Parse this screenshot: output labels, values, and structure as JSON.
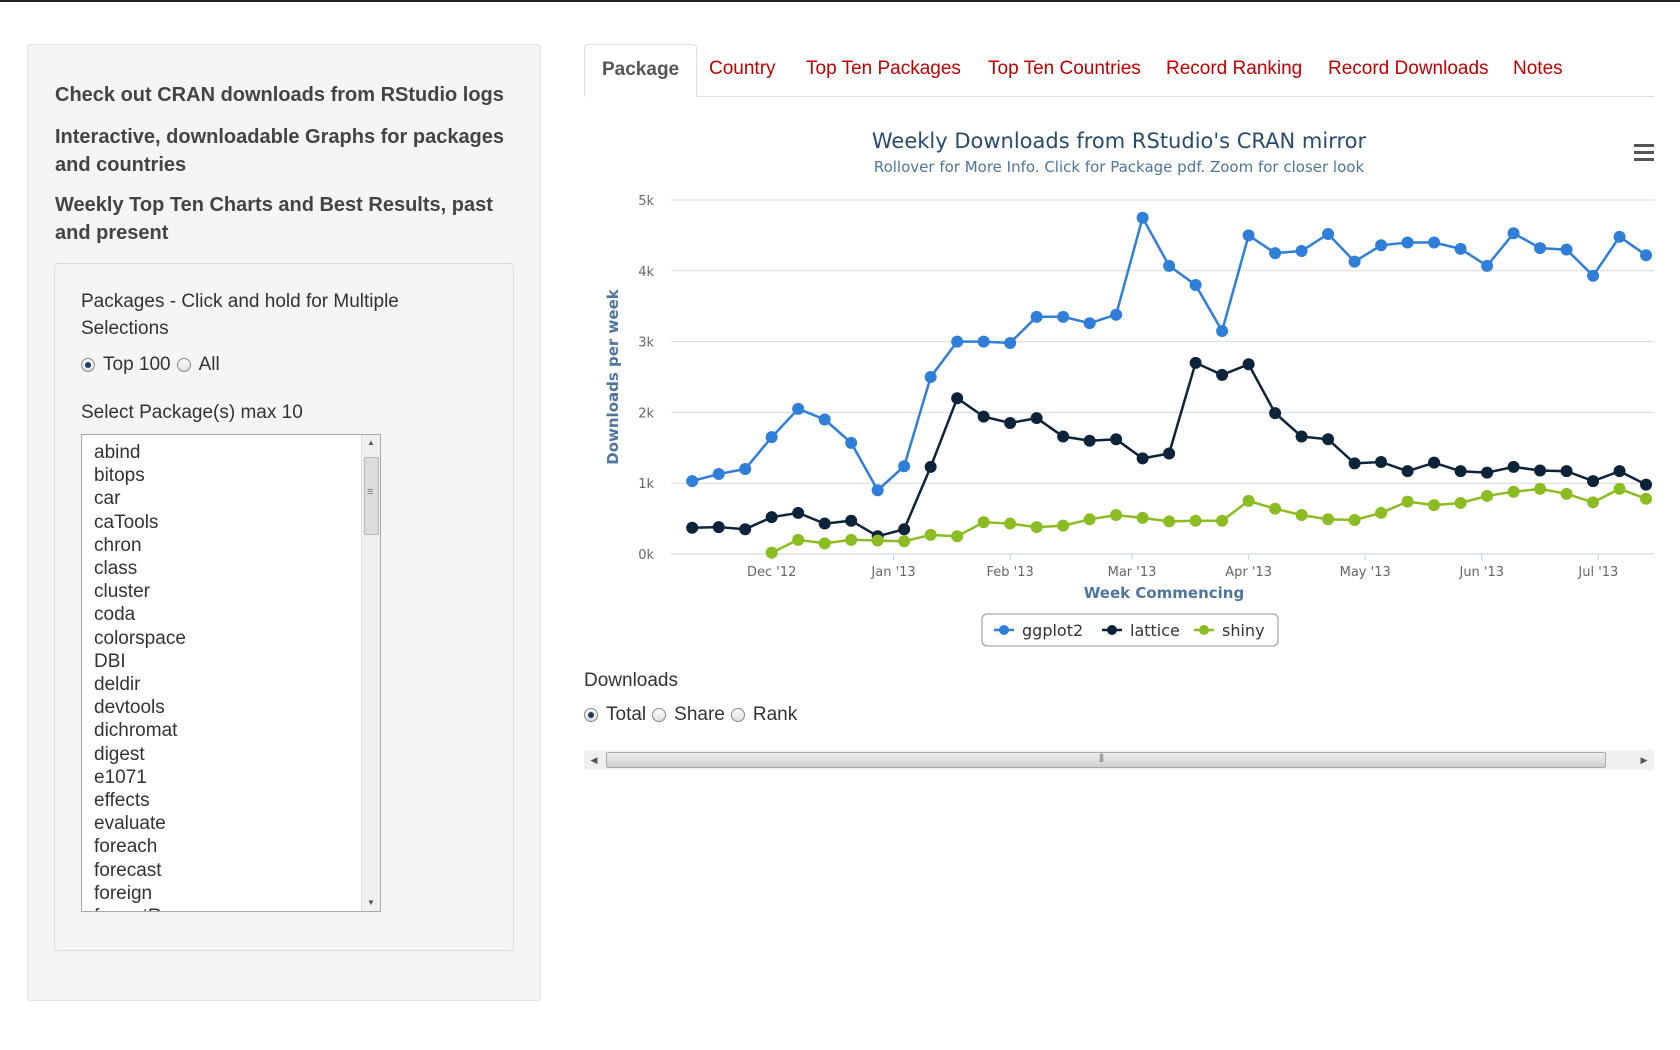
{
  "sidebar": {
    "heading1": "Check out CRAN downloads from RStudio logs",
    "heading2": "Interactive, downloadable Graphs for packages and countries",
    "heading3": "Weekly Top Ten Charts and Best Results, past and present",
    "packages_label": "Packages - Click and hold for Multiple Selections",
    "scope_options": [
      "Top 100",
      "All"
    ],
    "scope_selected": "Top 100",
    "select_label": "Select Package(s) max 10",
    "packages": [
      "abind",
      "bitops",
      "car",
      "caTools",
      "chron",
      "class",
      "cluster",
      "coda",
      "colorspace",
      "DBI",
      "deldir",
      "devtools",
      "dichromat",
      "digest",
      "e1071",
      "effects",
      "evaluate",
      "foreach",
      "forecast",
      "foreign",
      "formatR"
    ]
  },
  "tabs": [
    "Package",
    "Country",
    "Top Ten Packages",
    "Top Ten Countries",
    "Record Ranking",
    "Record Downloads",
    "Notes"
  ],
  "active_tab": "Package",
  "downloads": {
    "label": "Downloads",
    "options": [
      "Total",
      "Share",
      "Rank"
    ],
    "selected": "Total"
  },
  "colors": {
    "ggplot2": "#2f7ed8",
    "lattice": "#0d233a",
    "shiny": "#8bbc21",
    "tab_link": "#c00000"
  },
  "chart_data": {
    "type": "line",
    "title": "Weekly Downloads from RStudio's CRAN mirror",
    "subtitle": "Rollover for More Info. Click for Package pdf. Zoom for closer look",
    "xlabel": "Week Commencing",
    "ylabel": "Downloads per week",
    "ylim": [
      0,
      5000
    ],
    "yticks": [
      "0k",
      "1k",
      "2k",
      "3k",
      "4k",
      "5k"
    ],
    "xticks": [
      "Dec '12",
      "Jan '13",
      "Feb '13",
      "Mar '13",
      "Apr '13",
      "May '13",
      "Jun '13",
      "Jul '13"
    ],
    "legend_position": "bottom-center",
    "grid": true,
    "series": [
      {
        "name": "ggplot2",
        "points": [
          [
            -3,
            1030
          ],
          [
            -2,
            1130
          ],
          [
            -1,
            1200
          ],
          [
            0,
            1650
          ],
          [
            1,
            2050
          ],
          [
            2,
            1900
          ],
          [
            3,
            1570
          ],
          [
            4,
            900
          ],
          [
            5,
            1240
          ],
          [
            6,
            2500
          ],
          [
            7,
            3000
          ],
          [
            8,
            3000
          ],
          [
            9,
            2980
          ],
          [
            10,
            3350
          ],
          [
            11,
            3350
          ],
          [
            12,
            3260
          ],
          [
            13,
            3380
          ],
          [
            14,
            4750
          ],
          [
            15,
            4070
          ],
          [
            16,
            3800
          ],
          [
            17,
            3150
          ],
          [
            18,
            4500
          ],
          [
            19,
            4250
          ],
          [
            20,
            4280
          ],
          [
            21,
            4520
          ],
          [
            22,
            4130
          ],
          [
            23,
            4360
          ],
          [
            24,
            4400
          ],
          [
            25,
            4400
          ],
          [
            26,
            4310
          ],
          [
            27,
            4070
          ],
          [
            28,
            4530
          ],
          [
            29,
            4320
          ],
          [
            30,
            4300
          ],
          [
            31,
            3930
          ],
          [
            32,
            4480
          ],
          [
            33,
            4220
          ]
        ]
      },
      {
        "name": "lattice",
        "points": [
          [
            -3,
            370
          ],
          [
            -2,
            380
          ],
          [
            -1,
            350
          ],
          [
            0,
            520
          ],
          [
            1,
            580
          ],
          [
            2,
            430
          ],
          [
            3,
            470
          ],
          [
            4,
            250
          ],
          [
            5,
            350
          ],
          [
            6,
            1230
          ],
          [
            7,
            2200
          ],
          [
            8,
            1940
          ],
          [
            9,
            1850
          ],
          [
            10,
            1920
          ],
          [
            11,
            1660
          ],
          [
            12,
            1600
          ],
          [
            13,
            1620
          ],
          [
            14,
            1350
          ],
          [
            15,
            1420
          ],
          [
            16,
            2700
          ],
          [
            17,
            2530
          ],
          [
            18,
            2680
          ],
          [
            19,
            1990
          ],
          [
            20,
            1660
          ],
          [
            21,
            1620
          ],
          [
            22,
            1280
          ],
          [
            23,
            1300
          ],
          [
            24,
            1170
          ],
          [
            25,
            1290
          ],
          [
            26,
            1170
          ],
          [
            27,
            1150
          ],
          [
            28,
            1230
          ],
          [
            29,
            1180
          ],
          [
            30,
            1170
          ],
          [
            31,
            1030
          ],
          [
            32,
            1170
          ],
          [
            33,
            980
          ]
        ]
      },
      {
        "name": "shiny",
        "points": [
          [
            0,
            20
          ],
          [
            1,
            200
          ],
          [
            2,
            150
          ],
          [
            3,
            200
          ],
          [
            4,
            190
          ],
          [
            5,
            180
          ],
          [
            6,
            270
          ],
          [
            7,
            250
          ],
          [
            8,
            450
          ],
          [
            9,
            430
          ],
          [
            10,
            380
          ],
          [
            11,
            400
          ],
          [
            12,
            490
          ],
          [
            13,
            550
          ],
          [
            14,
            510
          ],
          [
            15,
            460
          ],
          [
            16,
            470
          ],
          [
            17,
            470
          ],
          [
            18,
            750
          ],
          [
            19,
            640
          ],
          [
            20,
            550
          ],
          [
            21,
            490
          ],
          [
            22,
            480
          ],
          [
            23,
            580
          ],
          [
            24,
            740
          ],
          [
            25,
            690
          ],
          [
            26,
            720
          ],
          [
            27,
            820
          ],
          [
            28,
            880
          ],
          [
            29,
            920
          ],
          [
            30,
            850
          ],
          [
            31,
            730
          ],
          [
            32,
            920
          ],
          [
            33,
            780
          ]
        ]
      }
    ],
    "xtick_positions": [
      0,
      4.6,
      9,
      13.6,
      18,
      22.4,
      26.8,
      31.2
    ]
  }
}
